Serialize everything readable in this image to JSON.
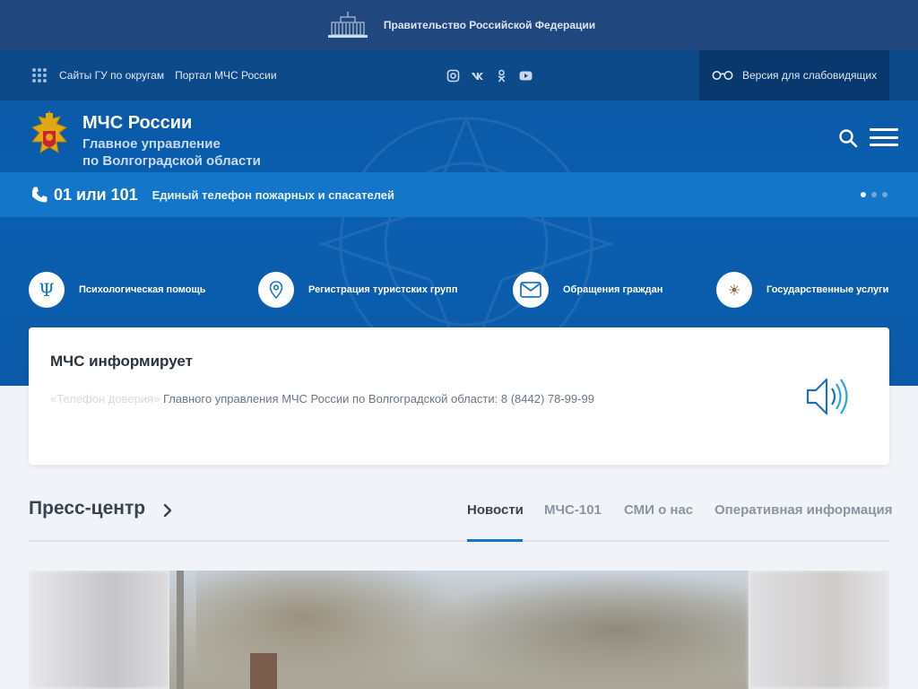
{
  "gov_bar": {
    "text": "Правительство Российской Федерации",
    "icon": "government-building-icon"
  },
  "util_bar": {
    "links": [
      "Сайты ГУ по округам",
      "Портал МЧС России"
    ],
    "social": [
      "instagram-icon",
      "vk-icon",
      "odnoklassniki-icon",
      "youtube-icon"
    ],
    "vision_label": "Версия для слабовидящих"
  },
  "header": {
    "title": "МЧС России",
    "subtitle_line1": "Главное управление",
    "subtitle_line2": "по Волгоградской области"
  },
  "phone": {
    "number": "01 или 101",
    "description": "Единый телефон пожарных и спасателей"
  },
  "services": [
    {
      "label": "Психологическая помощь",
      "icon": "psi-icon"
    },
    {
      "label": "Регистрация туристских групп",
      "icon": "map-pin-icon"
    },
    {
      "label": "Обращения граждан",
      "icon": "envelope-icon"
    },
    {
      "label": "Государственные услуги",
      "icon": "emblem-icon"
    }
  ],
  "info": {
    "title": "МЧС информирует",
    "text_fade": "«Телефон доверия» ",
    "text": "Главного управления МЧС России по Волгоградской области: 8 (8442) 78-99-99"
  },
  "press": {
    "title": "Пресс-центр",
    "tabs": [
      "Новости",
      "МЧС-101",
      "СМИ о нас",
      "Оперативная информация"
    ],
    "active_tab": "Новости"
  },
  "colors": {
    "gov_bar": "#20487f",
    "util_bar": "#0d4a8a",
    "hero": "#0a5aa8",
    "phone_strip": "#1476c9",
    "accent": "#1476c9"
  }
}
